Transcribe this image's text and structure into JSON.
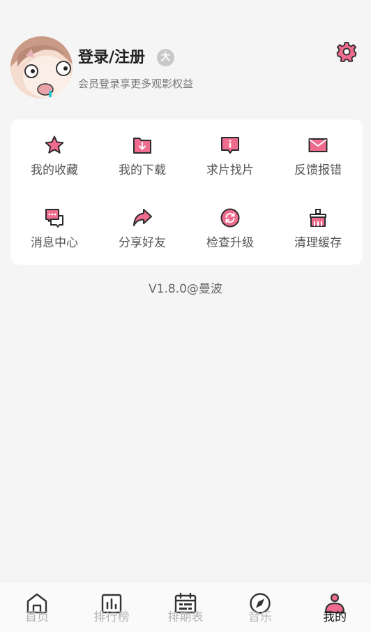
{
  "profile": {
    "title": "登录/注册",
    "badge": "大",
    "subtitle": "会员登录享更多观影权益"
  },
  "colors": {
    "accent": "#f06c8f",
    "outline": "#2b2b2b",
    "text_muted": "#777777",
    "nav_inactive": "#b5b5b5"
  },
  "menu": [
    {
      "label": "我的收藏",
      "icon": "star-icon"
    },
    {
      "label": "我的下载",
      "icon": "download-folder-icon"
    },
    {
      "label": "求片找片",
      "icon": "request-icon"
    },
    {
      "label": "反馈报错",
      "icon": "mail-icon"
    },
    {
      "label": "消息中心",
      "icon": "message-icon"
    },
    {
      "label": "分享好友",
      "icon": "share-icon"
    },
    {
      "label": "检查升级",
      "icon": "refresh-icon"
    },
    {
      "label": "清理缓存",
      "icon": "clean-icon"
    }
  ],
  "version": "V1.8.0@曼波",
  "nav": [
    {
      "label": "首页",
      "icon": "home-icon",
      "active": false
    },
    {
      "label": "排行榜",
      "icon": "chart-icon",
      "active": false
    },
    {
      "label": "排期表",
      "icon": "calendar-icon",
      "active": false
    },
    {
      "label": "音乐",
      "icon": "compass-icon",
      "active": false
    },
    {
      "label": "我的",
      "icon": "user-icon",
      "active": true
    }
  ]
}
